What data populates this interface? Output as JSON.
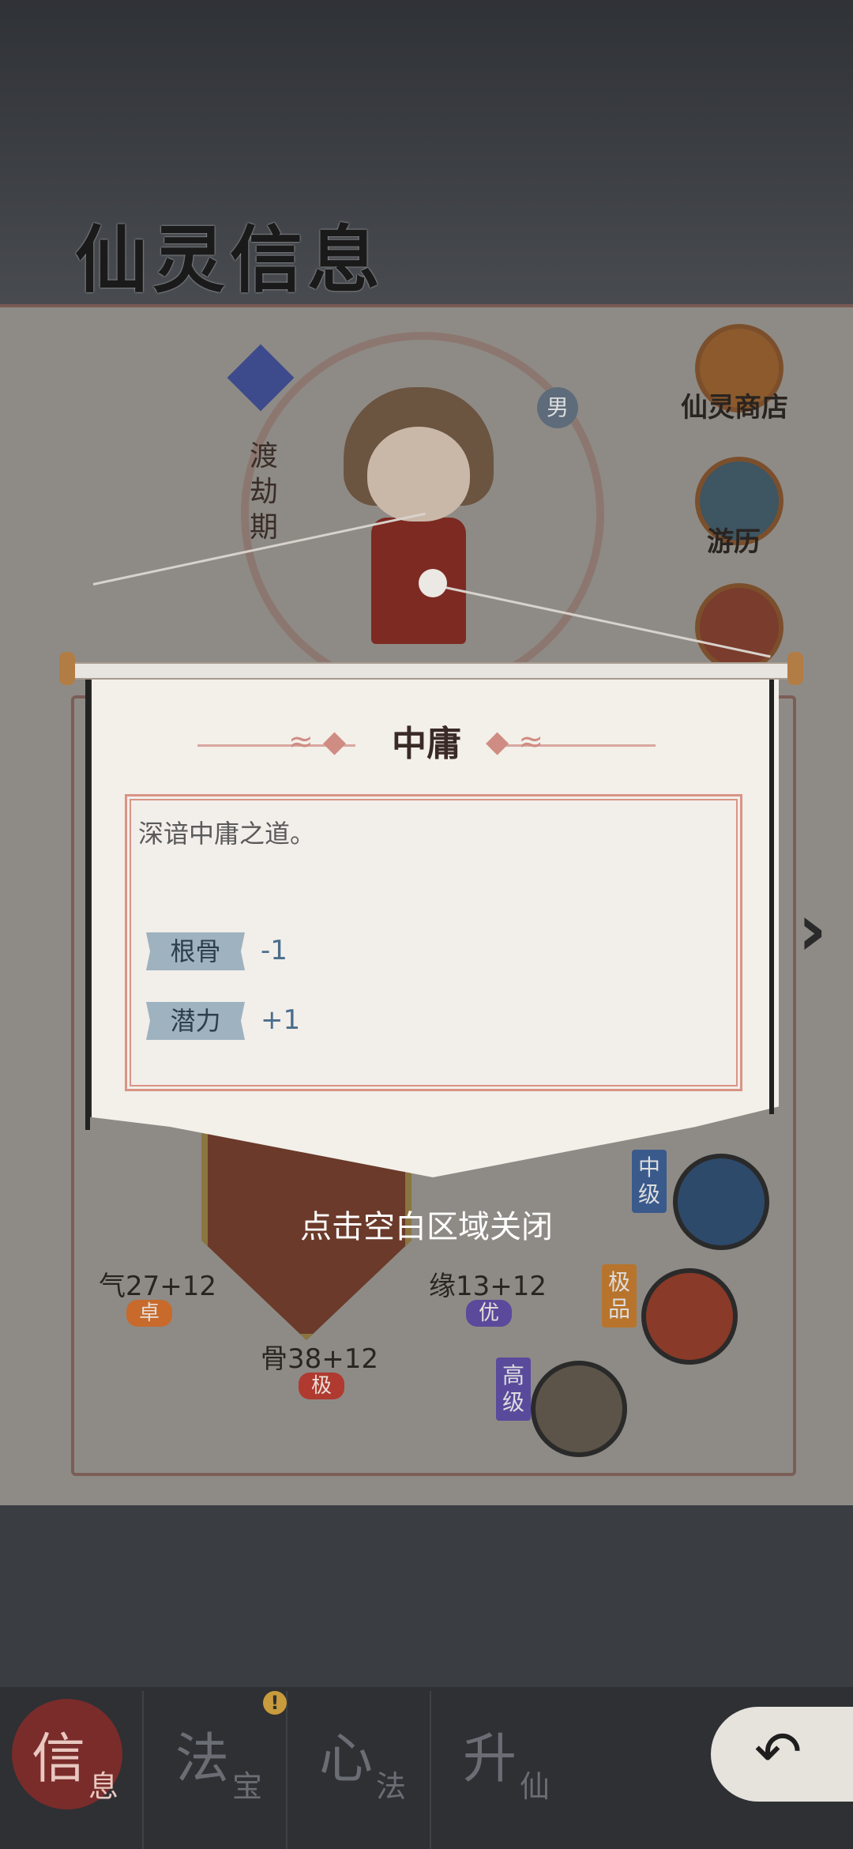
{
  "page_title": "仙灵信息",
  "sidebar": {
    "shop_label": "仙灵商店",
    "travel_label": "游历"
  },
  "character": {
    "realm": "渡劫期",
    "gender": "男"
  },
  "stats": {
    "qi": {
      "value": "气27+12",
      "grade": "卓"
    },
    "yuan": {
      "value": "缘13+12",
      "grade": "优"
    },
    "gu": {
      "value": "骨38+12",
      "grade": "极"
    }
  },
  "skills": [
    {
      "tier": "中级"
    },
    {
      "tier": "极品"
    },
    {
      "tier": "高级"
    }
  ],
  "popup": {
    "title": "中庸",
    "description": "深谙中庸之道。",
    "attributes": [
      {
        "label": "根骨",
        "value": "-1"
      },
      {
        "label": "潜力",
        "value": "+1"
      }
    ]
  },
  "close_hint": "点击空白区域关闭",
  "nav": {
    "tabs": [
      {
        "main": "信",
        "sub": "息"
      },
      {
        "main": "法",
        "sub": "宝"
      },
      {
        "main": "心",
        "sub": "法"
      },
      {
        "main": "升",
        "sub": "仙"
      }
    ],
    "alert_symbol": "!",
    "back_symbol": "↶"
  },
  "colors": {
    "accent_red": "#7a2c2a",
    "popup_border": "#d99486",
    "attr_label_bg": "#9eb2c0"
  }
}
